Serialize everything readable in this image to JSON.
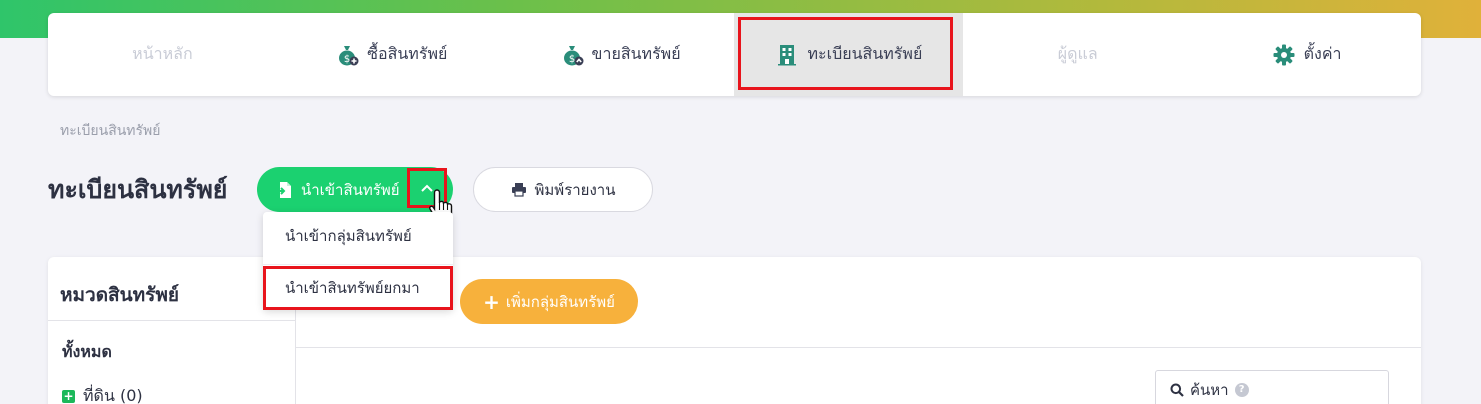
{
  "nav": {
    "items": [
      {
        "label": "หน้าหลัก",
        "icon": "home",
        "state": "disabled"
      },
      {
        "label": "ซื้อสินทรัพย์",
        "icon": "money-bag-plus-icon",
        "state": "normal"
      },
      {
        "label": "ขายสินทรัพย์",
        "icon": "money-bag-up-icon",
        "state": "normal"
      },
      {
        "label": "ทะเบียนสินทรัพย์",
        "icon": "building-icon",
        "state": "active"
      },
      {
        "label": "ผู้ดูแล",
        "icon": "user",
        "state": "disabled"
      },
      {
        "label": "ตั้งค่า",
        "icon": "gear-icon",
        "state": "normal"
      }
    ]
  },
  "breadcrumb": "ทะเบียนสินทรัพย์",
  "page": {
    "title": "ทะเบียนสินทรัพย์",
    "import_button": "นำเข้าสินทรัพย์",
    "print_button": "พิมพ์รายงาน"
  },
  "dropdown": {
    "items": [
      "นำเข้ากลุ่มสินทรัพย์",
      "นำเข้าสินทรัพย์ยกมา"
    ]
  },
  "sidebar": {
    "title": "หมวดสินทรัพย์",
    "all_label": "ทั้งหมด",
    "categories": [
      {
        "label": "ที่ดิน (0)"
      }
    ]
  },
  "main": {
    "add_group_button": "เพิ่มกลุ่มสินทรัพย์",
    "search_placeholder": "ค้นหา"
  },
  "colors": {
    "primary_green": "#1bd170",
    "accent_orange": "#f7b13c",
    "highlight_red": "#e8141c",
    "icon_green": "#2a8d7a"
  }
}
